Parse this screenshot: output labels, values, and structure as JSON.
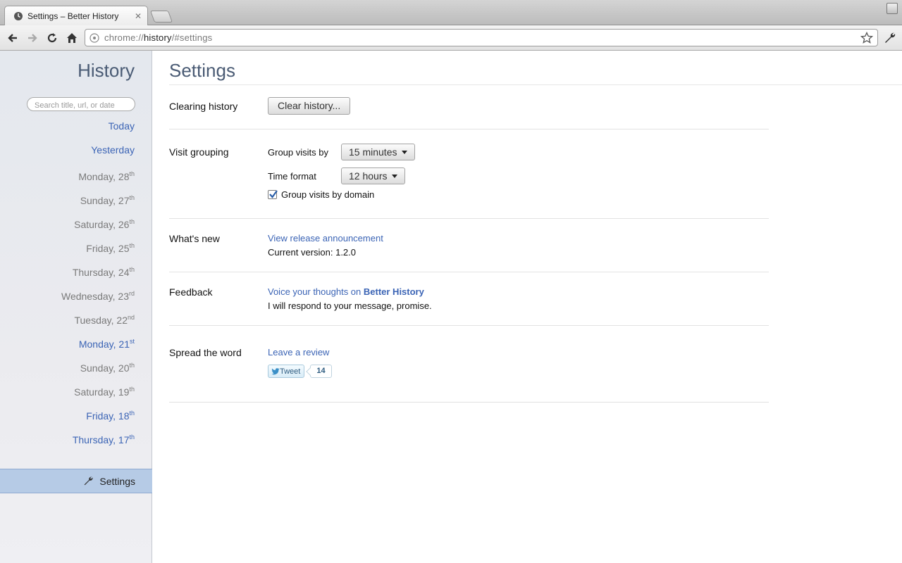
{
  "browser": {
    "tab_title": "Settings – Better History",
    "url_prefix": "chrome://",
    "url_host": "history",
    "url_rest": "/#settings"
  },
  "sidebar": {
    "title": "History",
    "search_placeholder": "Search title, url, or date",
    "days": [
      {
        "label": "Today",
        "sup": "",
        "style": "link"
      },
      {
        "label": "Yesterday",
        "sup": "",
        "style": "link"
      },
      {
        "label": "Monday, 28",
        "sup": "th",
        "style": "dim"
      },
      {
        "label": "Sunday, 27",
        "sup": "th",
        "style": "dim"
      },
      {
        "label": "Saturday, 26",
        "sup": "th",
        "style": "dim"
      },
      {
        "label": "Friday, 25",
        "sup": "th",
        "style": "dim"
      },
      {
        "label": "Thursday, 24",
        "sup": "th",
        "style": "dim"
      },
      {
        "label": "Wednesday, 23",
        "sup": "rd",
        "style": "dim"
      },
      {
        "label": "Tuesday, 22",
        "sup": "nd",
        "style": "dim"
      },
      {
        "label": "Monday, 21",
        "sup": "st",
        "style": "link"
      },
      {
        "label": "Sunday, 20",
        "sup": "th",
        "style": "dim"
      },
      {
        "label": "Saturday, 19",
        "sup": "th",
        "style": "dim"
      },
      {
        "label": "Friday, 18",
        "sup": "th",
        "style": "link"
      },
      {
        "label": "Thursday, 17",
        "sup": "th",
        "style": "link"
      }
    ],
    "settings_label": "Settings"
  },
  "main": {
    "title": "Settings",
    "clearing": {
      "label": "Clearing history",
      "button": "Clear history..."
    },
    "grouping": {
      "label": "Visit grouping",
      "group_by_label": "Group visits by",
      "group_by_value": "15 minutes",
      "time_format_label": "Time format",
      "time_format_value": "12 hours",
      "domain_checkbox_label": "Group visits by domain",
      "domain_checked": true
    },
    "whats_new": {
      "label": "What's new",
      "link": "View release announcement",
      "version": "Current version: 1.2.0"
    },
    "feedback": {
      "label": "Feedback",
      "link_prefix": "Voice your thoughts on ",
      "link_bold": "Better History",
      "note": "I will respond to your message, promise."
    },
    "spread": {
      "label": "Spread the word",
      "review_link": "Leave a review",
      "tweet_label": "Tweet",
      "tweet_count": "14"
    }
  }
}
